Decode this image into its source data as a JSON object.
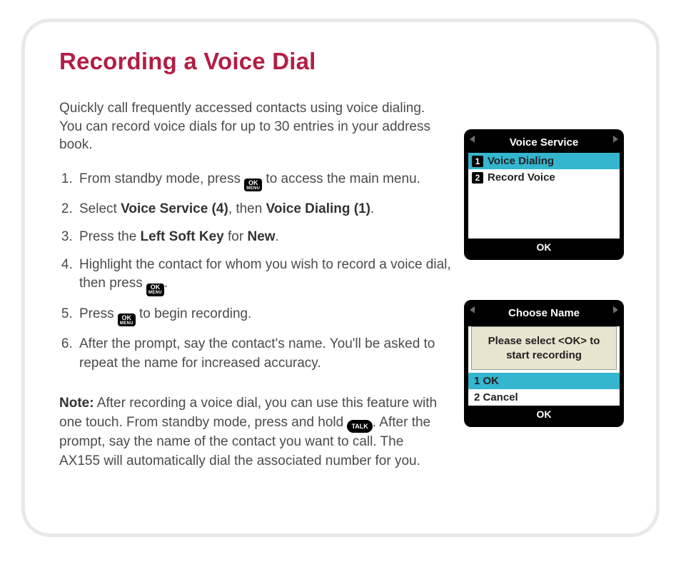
{
  "title": "Recording a Voice Dial",
  "intro": "Quickly call frequently accessed contacts using voice dialing. You can record voice dials for up to 30 entries in your address book.",
  "keys": {
    "ok_top": "OK",
    "ok_bottom": "MENU",
    "talk": "TALK"
  },
  "steps": {
    "s1a": "From standby mode, press ",
    "s1b": " to access the main menu.",
    "s2a": "Select ",
    "s2b": "Voice Service (4)",
    "s2c": ", then ",
    "s2d": "Voice Dialing (1)",
    "s2e": ".",
    "s3a": "Press the ",
    "s3b": "Left Soft Key",
    "s3c": " for ",
    "s3d": "New",
    "s3e": ".",
    "s4a": "Highlight the contact for whom you wish to record a voice dial, then press ",
    "s4b": ".",
    "s5a": "Press ",
    "s5b": " to begin recording.",
    "s6": "After the prompt, say the contact's name. You'll be asked to repeat the name for increased accuracy."
  },
  "note": {
    "label": "Note:",
    "a": " After recording a voice dial, you can use this feature with one touch. From standby mode, press and hold ",
    "b": ". After the prompt, say the name of the contact you want to call. The AX155 will automatically dial the associated number for you."
  },
  "phone1": {
    "title": "Voice Service",
    "items": [
      {
        "n": "1",
        "label": "Voice Dialing",
        "sel": true
      },
      {
        "n": "2",
        "label": "Record Voice",
        "sel": false
      }
    ],
    "footer": "OK"
  },
  "phone2": {
    "title": "Choose Name",
    "prompt": "Please select <OK> to start recording",
    "items": [
      {
        "label": "1 OK",
        "sel": true
      },
      {
        "label": "2 Cancel",
        "sel": false
      }
    ],
    "footer": "OK"
  }
}
